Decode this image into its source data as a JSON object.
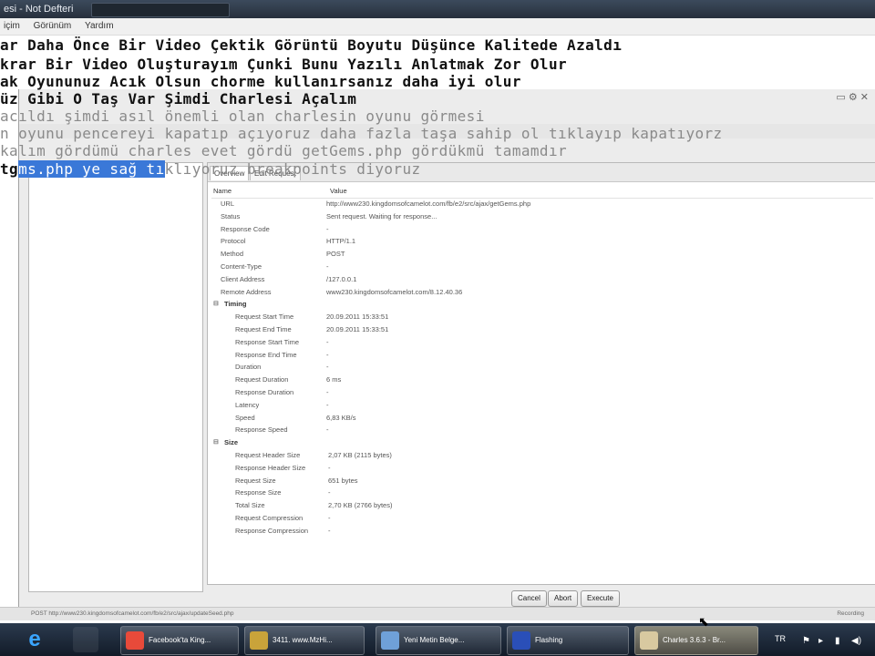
{
  "notepad": {
    "title": "esi - Not Defteri",
    "menu": [
      "içim",
      "Görünüm",
      "Yardım"
    ],
    "lines": [
      "ar Daha Önce Bir Video Çektik Görüntü Boyutu Düşünce Kalitede Azaldı",
      "krar Bir Video Oluşturayım Çunki  Bunu Yazılı Anlatmak Zor Olur",
      "ak Oyununuz Acık Olsun chorme kullanırsanız daha iyi olur",
      "üz Gibi O Taş Var Şimdi Charlesi Açalım",
      "acıldı şimdi asıl önemli olan charlesin oyunu görmesi",
      "n oyunu pencereyi kapatıp açıyoruz daha fazla taşa sahip ol tıklayıp kapatıyorz",
      "kalım gördümü charles evet gördü getGems.php gördükmü tamamdır"
    ],
    "last_line_prefix": "tg",
    "last_line_selected": "ms.php ye sağ tı",
    "last_line_rest": "klıyoruz breakpoints diyoruz"
  },
  "charles": {
    "tabs": [
      "Overview",
      "Edit Request"
    ],
    "col_name": "Name",
    "col_value": "Value",
    "rows": [
      {
        "k": "URL",
        "v": "http://www230.kingdomsofcamelot.com/fb/e2/src/ajax/getGems.php"
      },
      {
        "k": "Status",
        "v": "Sent request. Waiting for response..."
      },
      {
        "k": "Response Code",
        "v": "-"
      },
      {
        "k": "Protocol",
        "v": "HTTP/1.1"
      },
      {
        "k": "Method",
        "v": "POST"
      },
      {
        "k": "Content-Type",
        "v": "-"
      },
      {
        "k": "Client Address",
        "v": "/127.0.0.1"
      },
      {
        "k": "Remote Address",
        "v": "www230.kingdomsofcamelot.com/8.12.40.36"
      }
    ],
    "timing_label": "Timing",
    "timing": [
      {
        "k": "Request Start Time",
        "v": "20.09.2011 15:33:51"
      },
      {
        "k": "Request End Time",
        "v": "20.09.2011 15:33:51"
      },
      {
        "k": "Response Start Time",
        "v": "-"
      },
      {
        "k": "Response End Time",
        "v": "-"
      },
      {
        "k": "Duration",
        "v": "-"
      },
      {
        "k": "Request Duration",
        "v": "6 ms"
      },
      {
        "k": "Response Duration",
        "v": "-"
      },
      {
        "k": "Latency",
        "v": "-"
      },
      {
        "k": "Speed",
        "v": "6,83 KB/s"
      },
      {
        "k": "Response Speed",
        "v": "-"
      }
    ],
    "size_label": "Size",
    "size": [
      {
        "k": "Request Header Size",
        "v": "2,07 KB (2115 bytes)"
      },
      {
        "k": "Response Header Size",
        "v": "-"
      },
      {
        "k": "Request Size",
        "v": "651 bytes"
      },
      {
        "k": "Response Size",
        "v": "-"
      },
      {
        "k": "Total Size",
        "v": "2,70 KB (2766 bytes)"
      },
      {
        "k": "Request Compression",
        "v": "-"
      },
      {
        "k": "Response Compression",
        "v": "-"
      }
    ],
    "buttons": {
      "cancel": "Cancel",
      "abort": "Abort",
      "execute": "Execute"
    },
    "status_left": "POST http://www230.kingdomsofcamelot.com/fb/e2/src/ajax/updateSeed.php",
    "status_right": "Recording"
  },
  "taskbar": {
    "items": [
      {
        "label": "Facebook'ta King...",
        "color": "#e84a3a"
      },
      {
        "label": "3411. www.MzHi...",
        "color": "#c9a33a"
      },
      {
        "label": "Yeni Metin Belge...",
        "color": "#6fa0d8"
      },
      {
        "label": "Flashing",
        "color": "#2a4fb8"
      },
      {
        "label": "Charles 3.6.3 - Br...",
        "color": "#d8c9a0"
      }
    ],
    "lang": "TR"
  }
}
